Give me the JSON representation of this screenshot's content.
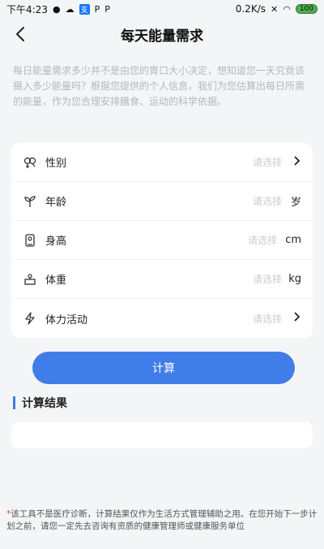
{
  "status_bar": {
    "time": "下午4:23",
    "pay_badge": "支",
    "p1": "P",
    "p2": "P",
    "speed": "0.2K/s",
    "battery": "100"
  },
  "header": {
    "title": "每天能量需求"
  },
  "intro_text": "每日能量需求多少并不是由您的胃口大小决定，想知道您一天究竟该摄入多少能量吗？根据您提供的个人信息，我们为您估算出每日所需的能量，作为您合理安排膳食、运动的科学依据。",
  "form": {
    "rows": [
      {
        "label": "性别",
        "placeholder": "请选择",
        "unit": ""
      },
      {
        "label": "年龄",
        "placeholder": "请选择",
        "unit": "岁"
      },
      {
        "label": "身高",
        "placeholder": "请选择",
        "unit": "cm"
      },
      {
        "label": "体重",
        "placeholder": "请选择",
        "unit": "kg"
      },
      {
        "label": "体力活动",
        "placeholder": "请选择",
        "unit": ""
      }
    ]
  },
  "calculate_button": "计算",
  "result_title": "计算结果",
  "disclaimer": {
    "star": "*",
    "text": "该工具不是医疗诊断，计算结果仅作为生活方式管理辅助之用。在您开始下一步计划之前，请您一定先去咨询有资质的健康管理师或健康服务单位"
  }
}
